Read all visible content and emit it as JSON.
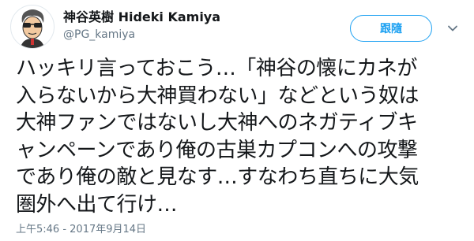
{
  "author": {
    "display_name": "神谷英樹 Hideki Kamiya",
    "screen_name": "@PG_kamiya",
    "avatar_icon": "cartoon-avatar-icon"
  },
  "actions": {
    "follow_label": "跟隨",
    "more_icon": "chevron-down-icon"
  },
  "tweet": {
    "text": "ハッキリ言っておこう…「神谷の懐にカネが\n入らないから大神買わない」などという奴は\n大神ファンではないし大神へのネガティブキ\nャンペーンであり俺の古巣カプコンへの攻撃\nであり俺の敵と見なす…すなわち直ちに大気\n圏外へ出て行け…",
    "timestamp": "上午5:46 - 2017年9月14日"
  },
  "colors": {
    "accent": "#1da1f2",
    "text_primary": "#14171a",
    "text_secondary": "#657786"
  }
}
